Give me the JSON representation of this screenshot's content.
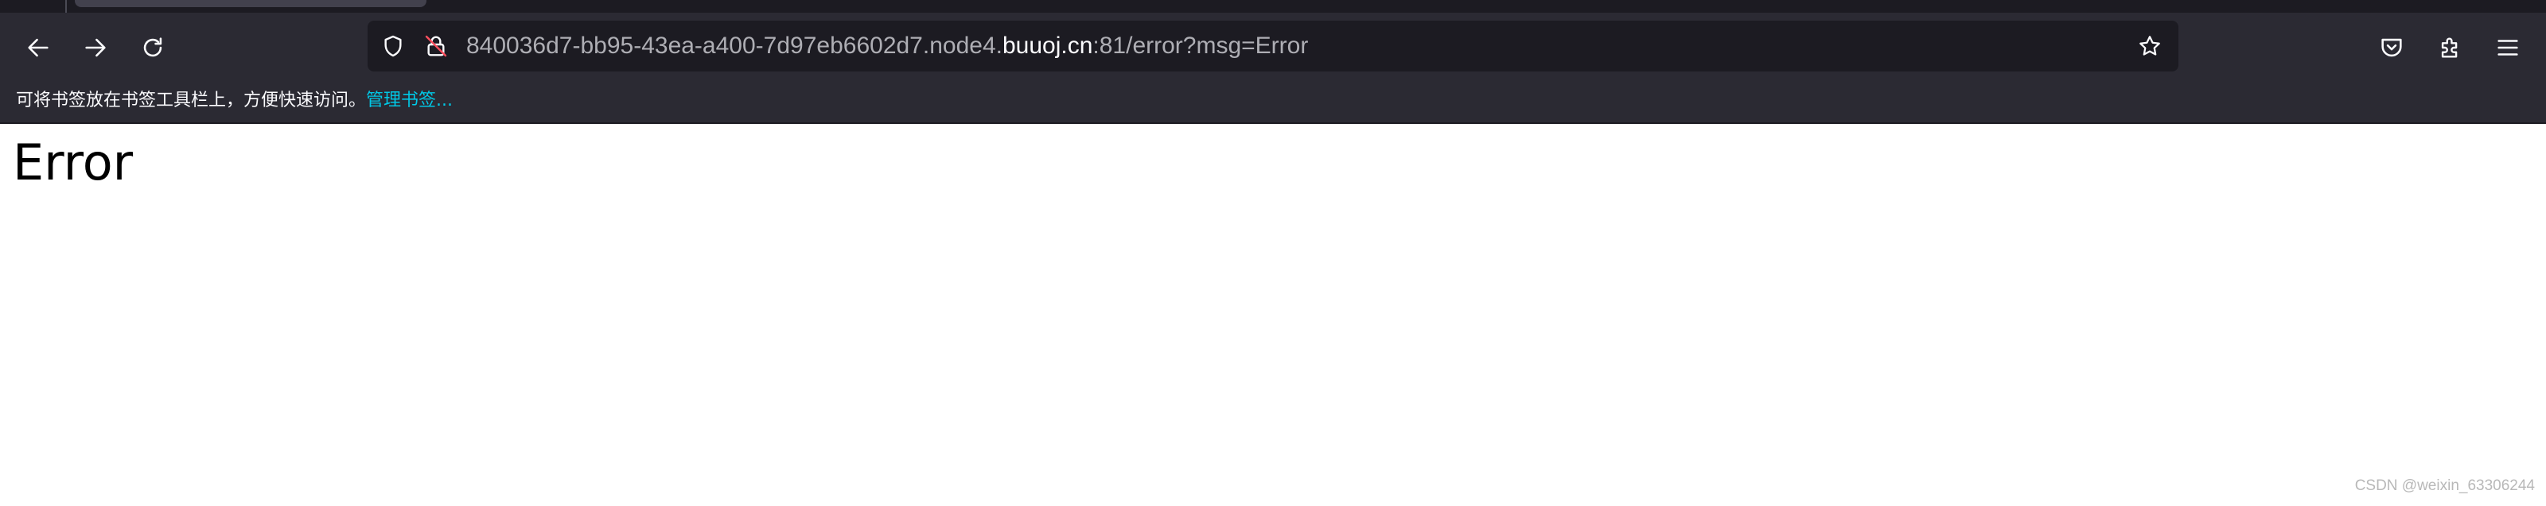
{
  "toolbar": {
    "back_icon": "arrow-left-icon",
    "forward_icon": "arrow-right-icon",
    "reload_icon": "reload-icon"
  },
  "urlbar": {
    "prefix": "840036d7-bb95-43ea-a400-7d97eb6602d7.node4.",
    "host": "buuoj.cn",
    "suffix": ":81/error?msg=Error",
    "shield_icon": "tracking-shield-icon",
    "lock_icon": "insecure-lock-icon",
    "star_icon": "bookmark-star-icon"
  },
  "right_toolbar": {
    "icons": [
      "pocket-icon",
      "extensions-icon",
      "menu-icon"
    ]
  },
  "bookmarks_bar": {
    "hint": "可将书签放在书签工具栏上，方便快速访问。",
    "manage_link": "管理书签..."
  },
  "page": {
    "heading": "Error"
  },
  "watermark": "CSDN @weixin_63306244",
  "colors": {
    "chrome_bg": "#2b2a33",
    "urlbar_bg": "#1c1b22",
    "link": "#00c8e6"
  }
}
